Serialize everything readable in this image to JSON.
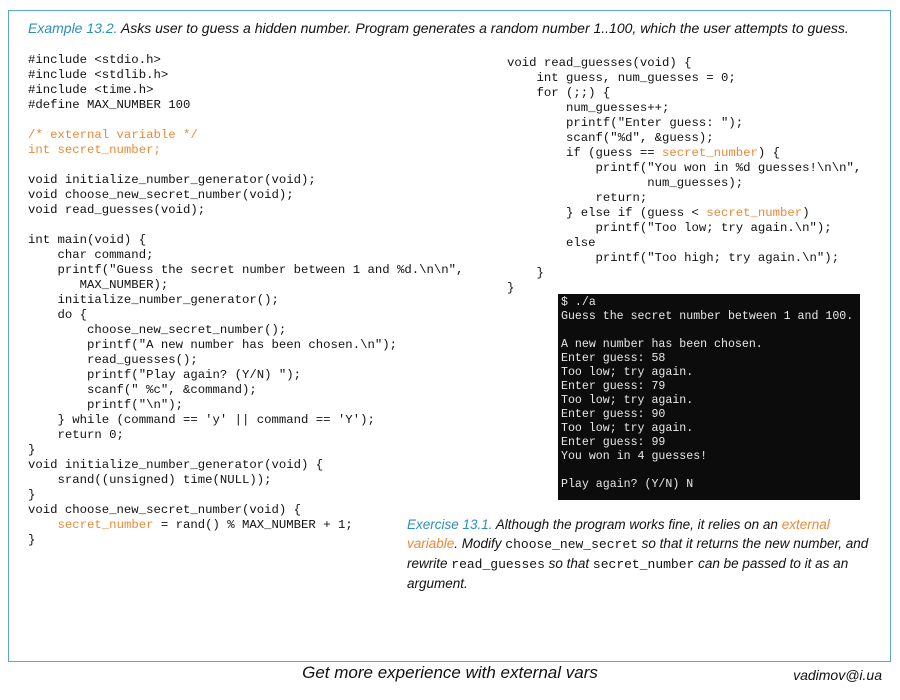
{
  "heading": {
    "label": "Example 13.2.",
    "text": " Asks user to guess a hidden number. Program generates a random number 1..100, which the user attempts to guess."
  },
  "code_left": [
    [
      {
        "t": "#include <stdio.h>"
      }
    ],
    [
      {
        "t": "#include <stdlib.h>"
      }
    ],
    [
      {
        "t": "#include <time.h>"
      }
    ],
    [
      {
        "t": "#define MAX_NUMBER 100"
      }
    ],
    [
      {
        "t": ""
      }
    ],
    [
      {
        "t": "/* external variable */",
        "h": true
      }
    ],
    [
      {
        "t": "int secret_number;",
        "h": true
      }
    ],
    [
      {
        "t": ""
      }
    ],
    [
      {
        "t": "void initialize_number_generator(void);"
      }
    ],
    [
      {
        "t": "void choose_new_secret_number(void);"
      }
    ],
    [
      {
        "t": "void read_guesses(void);"
      }
    ],
    [
      {
        "t": ""
      }
    ],
    [
      {
        "t": "int main(void) {"
      }
    ],
    [
      {
        "t": "    char command;"
      }
    ],
    [
      {
        "t": "    printf(\"Guess the secret number between 1 and %d.\\n\\n\","
      }
    ],
    [
      {
        "t": "       MAX_NUMBER);"
      }
    ],
    [
      {
        "t": "    initialize_number_generator();"
      }
    ],
    [
      {
        "t": "    do {"
      }
    ],
    [
      {
        "t": "        choose_new_secret_number();"
      }
    ],
    [
      {
        "t": "        printf(\"A new number has been chosen.\\n\");"
      }
    ],
    [
      {
        "t": "        read_guesses();"
      }
    ],
    [
      {
        "t": "        printf(\"Play again? (Y/N) \");"
      }
    ],
    [
      {
        "t": "        scanf(\" %c\", &command);"
      }
    ],
    [
      {
        "t": "        printf(\"\\n\");"
      }
    ],
    [
      {
        "t": "    } while (command == 'y' || command == 'Y');"
      }
    ],
    [
      {
        "t": "    return 0;"
      }
    ],
    [
      {
        "t": "}"
      }
    ],
    [
      {
        "t": "void initialize_number_generator(void) {"
      }
    ],
    [
      {
        "t": "    srand((unsigned) time(NULL));"
      }
    ],
    [
      {
        "t": "}"
      }
    ],
    [
      {
        "t": "void choose_new_secret_number(void) {"
      }
    ],
    [
      {
        "t": "    "
      },
      {
        "t": "secret_number",
        "h": true
      },
      {
        "t": " = rand() % MAX_NUMBER + 1;"
      }
    ],
    [
      {
        "t": "}"
      }
    ]
  ],
  "code_right": [
    [
      {
        "t": "void read_guesses(void) {"
      }
    ],
    [
      {
        "t": "    int guess, num_guesses = 0;"
      }
    ],
    [
      {
        "t": "    for (;;) {"
      }
    ],
    [
      {
        "t": "        num_guesses++;"
      }
    ],
    [
      {
        "t": "        printf(\"Enter guess: \");"
      }
    ],
    [
      {
        "t": "        scanf(\"%d\", &guess);"
      }
    ],
    [
      {
        "t": "        if (guess == "
      },
      {
        "t": "secret_number",
        "h": true
      },
      {
        "t": ") {"
      }
    ],
    [
      {
        "t": "            printf(\"You won in %d guesses!\\n\\n\","
      }
    ],
    [
      {
        "t": "                   num_guesses);"
      }
    ],
    [
      {
        "t": "            return;"
      }
    ],
    [
      {
        "t": "        } else if (guess < "
      },
      {
        "t": "secret_number",
        "h": true
      },
      {
        "t": ")"
      }
    ],
    [
      {
        "t": "            printf(\"Too low; try again.\\n\");"
      }
    ],
    [
      {
        "t": "        else"
      }
    ],
    [
      {
        "t": "            printf(\"Too high; try again.\\n\");"
      }
    ],
    [
      {
        "t": "    }"
      }
    ],
    [
      {
        "t": "}"
      }
    ]
  ],
  "terminal": {
    "text": "$ ./a\nGuess the secret number between 1 and 100.\n\nA new number has been chosen.\nEnter guess: 58\nToo low; try again.\nEnter guess: 79\nToo low; try again.\nEnter guess: 90\nToo low; try again.\nEnter guess: 99\nYou won in 4 guesses!\n\nPlay again? (Y/N) N"
  },
  "exercise": {
    "label": "Exercise 13.1.",
    "text_1": "  Although the program works fine, it relies on an ",
    "highlight": "external variable",
    "text_2": ".  Modify ",
    "code_1": "choose_new_secret",
    "text_3": " so that it returns the new number, and rewrite ",
    "code_2": "read_guesses",
    "text_4": " so that ",
    "code_3": "secret_number",
    "text_5": " can be passed to it as an argument."
  },
  "footer": {
    "title": "Get more experience with external vars",
    "email": "vadimov@i.ua"
  },
  "colors": {
    "accent_blue": "#2a8fbd",
    "highlight_orange": "#e88a3a",
    "terminal_bg": "#0c0c0c"
  }
}
